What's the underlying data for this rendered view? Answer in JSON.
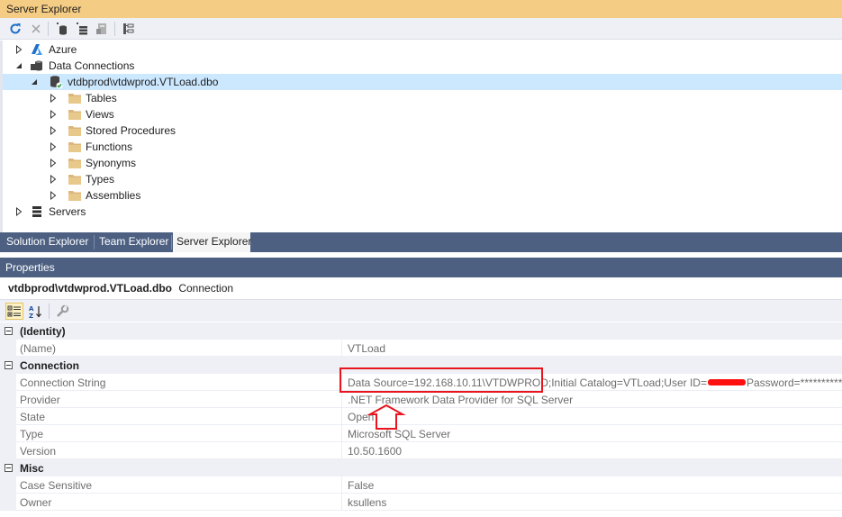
{
  "server_explorer": {
    "title": "Server Explorer",
    "toolbar": {
      "icons": [
        "refresh-icon",
        "stop-icon",
        "connect-to-database-icon",
        "connect-to-server-icon",
        "connect-to-azure-icon",
        "sharepoint-icon"
      ]
    },
    "tree": [
      {
        "label": "Azure",
        "icon": "azure-icon",
        "expanded": false,
        "level": 0
      },
      {
        "label": "Data Connections",
        "icon": "data-connections-icon",
        "expanded": true,
        "level": 0
      },
      {
        "label": "vtdbprod\\vtdwprod.VTLoad.dbo",
        "icon": "database-connection-icon",
        "expanded": true,
        "level": 1,
        "selected": true
      },
      {
        "label": "Tables",
        "icon": "folder-icon",
        "expanded": false,
        "level": 2
      },
      {
        "label": "Views",
        "icon": "folder-icon",
        "expanded": false,
        "level": 2
      },
      {
        "label": "Stored Procedures",
        "icon": "folder-icon",
        "expanded": false,
        "level": 2
      },
      {
        "label": "Functions",
        "icon": "folder-icon",
        "expanded": false,
        "level": 2
      },
      {
        "label": "Synonyms",
        "icon": "folder-icon",
        "expanded": false,
        "level": 2
      },
      {
        "label": "Types",
        "icon": "folder-icon",
        "expanded": false,
        "level": 2
      },
      {
        "label": "Assemblies",
        "icon": "folder-icon",
        "expanded": false,
        "level": 2
      },
      {
        "label": "Servers",
        "icon": "servers-icon",
        "expanded": false,
        "level": 0
      }
    ]
  },
  "tabs": [
    {
      "label": "Solution Explorer",
      "active": false
    },
    {
      "label": "Team Explorer",
      "active": false
    },
    {
      "label": "Server Explorer",
      "active": true
    }
  ],
  "properties": {
    "title": "Properties",
    "object_name": "vtdbprod\\vtdwprod.VTLoad.dbo",
    "object_type": "Connection",
    "toolbar": {
      "icons": [
        "categorized-icon",
        "alphabetical-icon",
        "property-pages-icon"
      ]
    },
    "categories": [
      {
        "name": "(Identity)",
        "rows": [
          {
            "name": "(Name)",
            "value": "VTLoad"
          }
        ]
      },
      {
        "name": "Connection",
        "rows": [
          {
            "name": "Connection String",
            "value_part1": "Data Source=192.168.10.11\\VTDWPROD;Initial Catalog=VTLoad;User ID=",
            "value_part2": "Password=***********"
          },
          {
            "name": "Provider",
            "value": ".NET Framework Data Provider for SQL Server"
          },
          {
            "name": "State",
            "value": "Open"
          },
          {
            "name": "Type",
            "value": "Microsoft SQL Server"
          },
          {
            "name": "Version",
            "value": "10.50.1600"
          }
        ]
      },
      {
        "name": "Misc",
        "rows": [
          {
            "name": "Case Sensitive",
            "value": "False"
          },
          {
            "name": "Owner",
            "value": "ksullens"
          }
        ]
      }
    ]
  },
  "annotation": {
    "color": "#e8141e"
  }
}
